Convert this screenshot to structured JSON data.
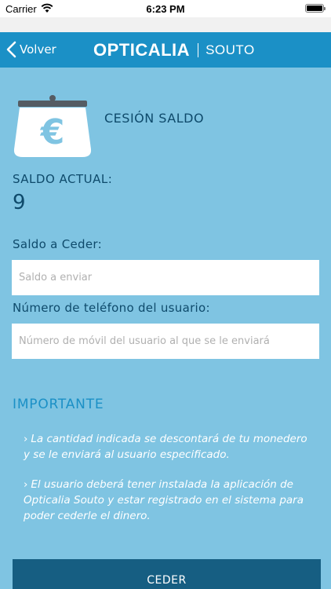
{
  "status_bar": {
    "carrier": "Carrier",
    "time": "6:23 PM"
  },
  "nav": {
    "back_label": "Volver",
    "brand": "OPTICALIA",
    "store": "SOUTO"
  },
  "header": {
    "icon": "purse-euro-icon",
    "title": "CESIÓN SALDO"
  },
  "balance": {
    "label": "SALDO ACTUAL:",
    "value": "9"
  },
  "form": {
    "amount_label": "Saldo a Ceder:",
    "amount_placeholder": "Saldo a enviar",
    "phone_label": "Número de teléfono del usuario:",
    "phone_placeholder": "Número de móvil del usuario al que se le enviará"
  },
  "important": {
    "title": "IMPORTANTE",
    "notes": [
      "La cantidad indicada se descontará de tu monedero y se le enviará al usuario especificado.",
      "El usuario deberá tener instalada la aplicación de Opticalia Souto y estar registrado en el sistema para poder cederle el dinero."
    ]
  },
  "actions": {
    "submit_label": "CEDER"
  },
  "colors": {
    "background": "#7fc4e2",
    "nav": "#1b90c6",
    "button": "#165e82",
    "text_dark": "#0e4a6b"
  }
}
